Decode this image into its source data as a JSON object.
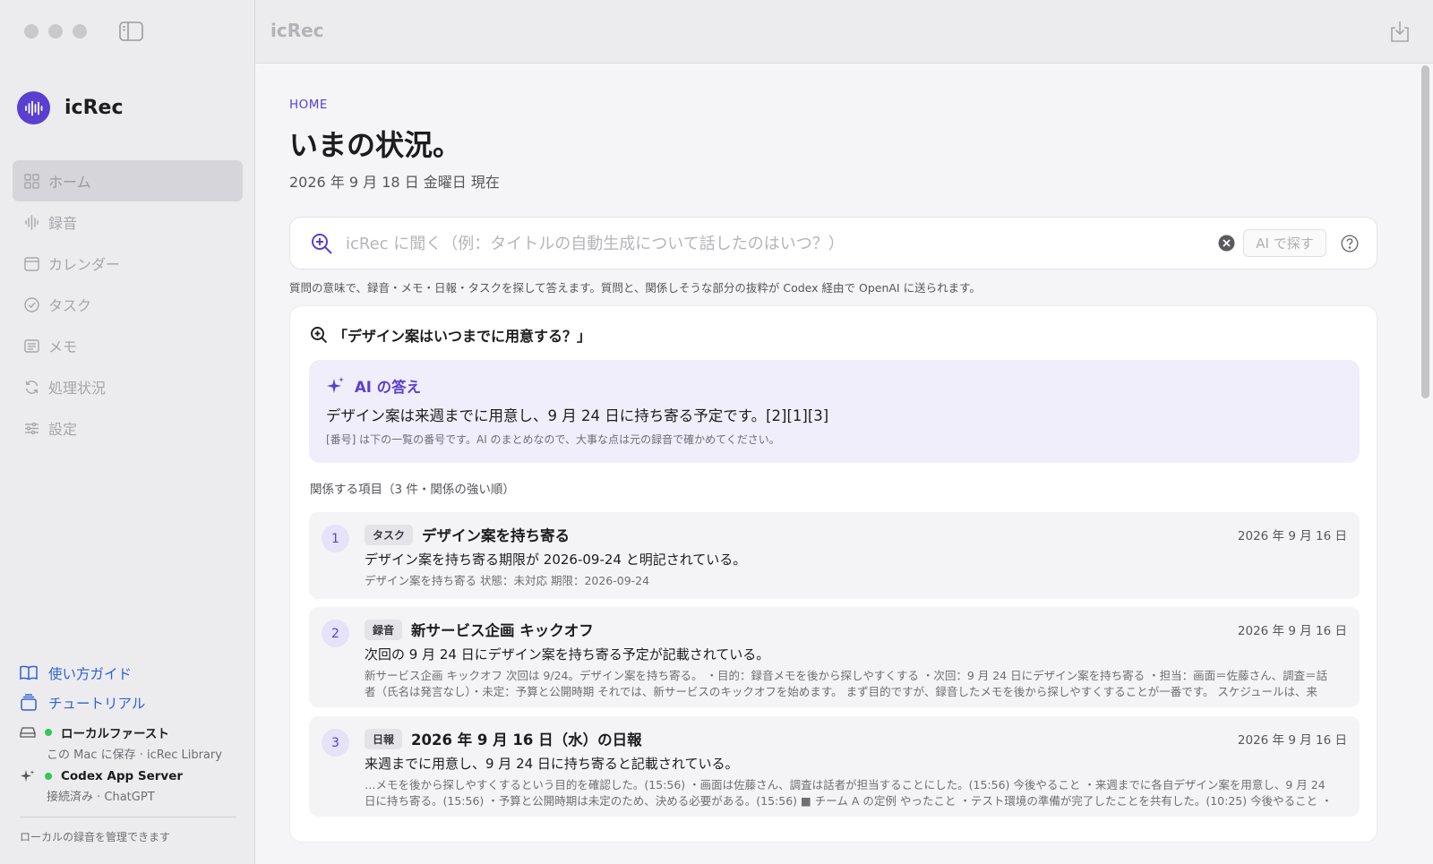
{
  "app": {
    "name": "icRec",
    "window_title": "icRec"
  },
  "sidebar": {
    "nav": [
      {
        "label": "ホーム",
        "icon": "grid-icon",
        "active": true
      },
      {
        "label": "録音",
        "icon": "waveform-icon"
      },
      {
        "label": "カレンダー",
        "icon": "calendar-icon"
      },
      {
        "label": "タスク",
        "icon": "check-circle-icon"
      },
      {
        "label": "メモ",
        "icon": "note-icon"
      },
      {
        "label": "処理状況",
        "icon": "refresh-icon"
      },
      {
        "label": "設定",
        "icon": "sliders-icon"
      }
    ],
    "links": [
      {
        "label": "使い方ガイド",
        "icon": "book-icon"
      },
      {
        "label": "チュートリアル",
        "icon": "stack-icon"
      }
    ],
    "statuses": [
      {
        "title": "ローカルファースト",
        "sub": "この Mac に保存 · icRec Library",
        "icon": "drive-icon"
      },
      {
        "title": "Codex App Server",
        "sub": "接続済み · ChatGPT",
        "icon": "sparkle-icon"
      }
    ],
    "footer": "ローカルの録音を管理できます"
  },
  "main": {
    "eyebrow": "HOME",
    "title": "いまの状況。",
    "date": "2026 年 9 月 18 日 金曜日 現在",
    "search": {
      "placeholder": "icRec に聞く（例：タイトルの自動生成について話したのはいつ？）",
      "ai_button": "AI で探す",
      "note": "質問の意味で、録音・メモ・日報・タスクを探して答えます。質問と、関係しそうな部分の抜粋が Codex 経由で OpenAI に送られます。"
    },
    "result": {
      "query": "「デザイン案はいつまでに用意する？」",
      "answer_title": "AI の答え",
      "answer_text": "デザイン案は来週までに用意し、9 月 24 日に持ち寄る予定です。[2][1][3]",
      "answer_note": "[番号] は下の一覧の番号です。AI のまとめなので、大事な点は元の録音で確かめてください。",
      "related_heading": "関係する項目（3 件・関係の強い順）",
      "items": [
        {
          "num": "1",
          "tag": "タスク",
          "title": "デザイン案を持ち寄る",
          "date": "2026 年 9 月 16 日",
          "summary": "デザイン案を持ち寄る期限が 2026-09-24 と明記されている。",
          "detail": "デザイン案を持ち寄る 状態：未対応 期限：2026-09-24"
        },
        {
          "num": "2",
          "tag": "録音",
          "title": "新サービス企画 キックオフ",
          "date": "2026 年 9 月 16 日",
          "summary": "次回の 9 月 24 日にデザイン案を持ち寄る予定が記載されている。",
          "detail": "新サービス企画 キックオフ 次回は 9/24。デザイン案を持ち寄る。 ・目的：録音メモを後から探しやすくする ・次回：9 月 24 日にデザイン案を持ち寄る ・担当：画面＝佐藤さん、調査＝話者（氏名は発言なし）・未定：予算と公開時期 それでは、新サービスのキックオフを始めます。 まず目的ですが、録音したメモを後から探しやすくすることが一番です。 スケジュールは、来週…"
        },
        {
          "num": "3",
          "tag": "日報",
          "title": "2026 年 9 月 16 日（水）の日報",
          "date": "2026 年 9 月 16 日",
          "summary": "来週までに用意し、9 月 24 日に持ち寄ると記載されている。",
          "detail": "…メモを後から探しやすくするという目的を確認した。(15:56) ・画面は佐藤さん、調査は話者が担当することにした。(15:56) 今後やること ・来週までに各自デザイン案を用意し、9 月 24 日に持ち寄る。(15:56) ・予算と公開時期は未定のため、決める必要がある。(15:56) ■ チーム A の定例 やったこと ・テスト環境の準備が完了したことを共有した。(10:25) 今後やること ・資…"
        }
      ]
    }
  },
  "colors": {
    "accent": "#5b3fd1",
    "link": "#2f61d6",
    "status_ok": "#34c759"
  }
}
